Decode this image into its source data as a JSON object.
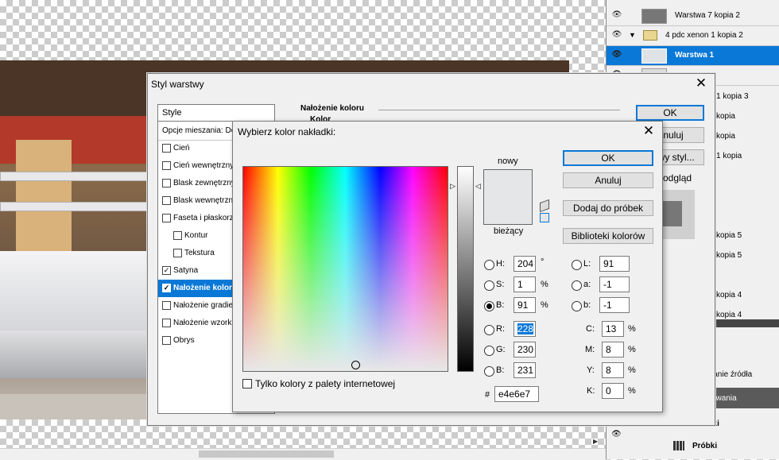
{
  "layers": [
    {
      "name": "Warstwa 7 kopia 2",
      "selected": false,
      "folder": false,
      "eye": true
    },
    {
      "name": "4 pdc xenon 1 kopia 2",
      "selected": false,
      "folder": true,
      "eye": true
    },
    {
      "name": "Warstwa 1",
      "selected": true,
      "folder": false,
      "eye": true
    },
    {
      "name": "",
      "selected": false,
      "folder": false,
      "eye": true
    }
  ],
  "layer_partial_names": [
    "1 kopia 3",
    "kopia",
    "kopia",
    "1 kopia",
    "",
    "kopia 5",
    "kopia 5",
    "",
    "kopia 4",
    "kopia 4"
  ],
  "right_panel_lower": {
    "item1": "t",
    "item2": "lanie źródła",
    "item3": "owania",
    "notatki": "Notatki",
    "probki": "Próbki"
  },
  "style_dialog": {
    "title": "Styl warstwy",
    "close_glyph": "✕",
    "styles_header": "Style",
    "blend_options": "Opcje mieszania: Domyślne",
    "items": [
      {
        "label": "Cień",
        "checked": false,
        "indent": false,
        "selected": false
      },
      {
        "label": "Cień wewnętrzny",
        "checked": false,
        "indent": false,
        "selected": false
      },
      {
        "label": "Blask zewnętrzny",
        "checked": false,
        "indent": false,
        "selected": false
      },
      {
        "label": "Blask wewnętrzny",
        "checked": false,
        "indent": false,
        "selected": false
      },
      {
        "label": "Faseta i płaskorzeźba",
        "checked": false,
        "indent": false,
        "selected": false
      },
      {
        "label": "Kontur",
        "checked": false,
        "indent": true,
        "selected": false
      },
      {
        "label": "Tekstura",
        "checked": false,
        "indent": true,
        "selected": false
      },
      {
        "label": "Satyna",
        "checked": true,
        "indent": false,
        "selected": false
      },
      {
        "label": "Nałożenie koloru",
        "checked": true,
        "indent": false,
        "selected": true
      },
      {
        "label": "Nałożenie gradientu",
        "checked": false,
        "indent": false,
        "selected": false
      },
      {
        "label": "Nałożenie wzorku",
        "checked": false,
        "indent": false,
        "selected": false
      },
      {
        "label": "Obrys",
        "checked": false,
        "indent": false,
        "selected": false
      }
    ],
    "section_title": "Nałożenie koloru",
    "section_sub": "Kolor",
    "ok": "OK",
    "cancel": "Anuluj",
    "new_style": "Nowy styl...",
    "preview": "Podgląd"
  },
  "picker": {
    "title": "Wybierz kolor nakładki:",
    "close_glyph": "✕",
    "new_label": "nowy",
    "current_label": "bieżący",
    "ok": "OK",
    "cancel": "Anuluj",
    "add_swatch": "Dodaj do próbek",
    "libraries": "Biblioteki kolorów",
    "web_only": "Tylko kolory z palety internetowej",
    "hsb": {
      "H": "204",
      "S": "1",
      "B": "91",
      "H_unit": "°",
      "S_unit": "%",
      "B_unit": "%"
    },
    "lab": {
      "L": "91",
      "a": "-1",
      "b": "-1"
    },
    "rgb": {
      "R": "228",
      "G": "230",
      "B": "231"
    },
    "cmyk": {
      "C": "13",
      "M": "8",
      "Y": "8",
      "K": "0",
      "unit": "%"
    },
    "hex": "e4e6e7",
    "hash": "#",
    "selected_radio": "B",
    "new_color": "#e4e6e7",
    "current_color": "#e4e6e7"
  }
}
